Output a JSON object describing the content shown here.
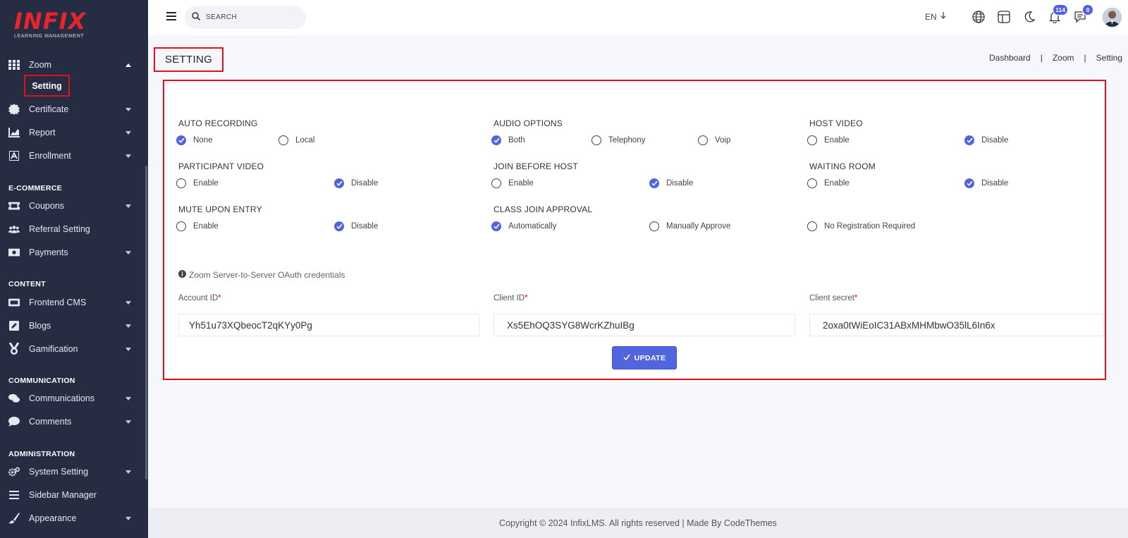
{
  "brand": {
    "logo_text": "INFIX",
    "logo_subtitle": "LEARNING MANAGEMENT"
  },
  "sidebar": {
    "items": [
      {
        "label": "Zoom",
        "icon": "grid-icon"
      },
      {
        "label": "Setting"
      },
      {
        "label": "Certificate",
        "icon": "certificate-icon"
      },
      {
        "label": "Report",
        "icon": "chart-icon"
      },
      {
        "label": "Enrollment",
        "icon": "enrollment-icon"
      },
      {
        "label": "Coupons",
        "icon": "ticket-icon"
      },
      {
        "label": "Referral Setting",
        "icon": "users-icon"
      },
      {
        "label": "Payments",
        "icon": "money-icon"
      },
      {
        "label": "Frontend CMS",
        "icon": "layers-icon"
      },
      {
        "label": "Blogs",
        "icon": "edit-icon"
      },
      {
        "label": "Gamification",
        "icon": "medal-icon"
      },
      {
        "label": "Communications",
        "icon": "chat-icon"
      },
      {
        "label": "Comments",
        "icon": "comment-icon"
      },
      {
        "label": "System Setting",
        "icon": "gears-icon"
      },
      {
        "label": "Sidebar Manager",
        "icon": "bars-icon"
      },
      {
        "label": "Appearance",
        "icon": "brush-icon"
      }
    ],
    "sections": [
      "E-COMMERCE",
      "CONTENT",
      "COMMUNICATION",
      "ADMINISTRATION"
    ]
  },
  "topbar": {
    "search_placeholder": "SEARCH",
    "language": "EN",
    "notifications_count": "114",
    "messages_count": "0"
  },
  "page": {
    "title": "SETTING",
    "breadcrumb": [
      "Dashboard",
      "|",
      "Zoom",
      "|",
      "Setting"
    ]
  },
  "settings": {
    "auto_recording": {
      "title": "AUTO RECORDING",
      "options": [
        "None",
        "Local"
      ],
      "selected": "None"
    },
    "audio_options": {
      "title": "AUDIO OPTIONS",
      "options": [
        "Both",
        "Telephony",
        "Voip"
      ],
      "selected": "Both"
    },
    "host_video": {
      "title": "HOST VIDEO",
      "options": [
        "Enable",
        "Disable"
      ],
      "selected": "Disable"
    },
    "participant_video": {
      "title": "PARTICIPANT VIDEO",
      "options": [
        "Enable",
        "Disable"
      ],
      "selected": "Disable"
    },
    "join_before_host": {
      "title": "JOIN BEFORE HOST",
      "options": [
        "Enable",
        "Disable"
      ],
      "selected": "Disable"
    },
    "waiting_room": {
      "title": "WAITING ROOM",
      "options": [
        "Enable",
        "Disable"
      ],
      "selected": "Disable"
    },
    "mute_upon_entry": {
      "title": "MUTE UPON ENTRY",
      "options": [
        "Enable",
        "Disable"
      ],
      "selected": "Disable"
    },
    "class_join_approval": {
      "title": "CLASS JOIN APPROVAL",
      "options": [
        "Automatically",
        "Manually Approve",
        "No Registration Required"
      ],
      "selected": "Automatically"
    }
  },
  "credentials": {
    "note": "Zoom Server-to-Server OAuth credentials",
    "account_id": {
      "label": "Account ID",
      "value": "Yh51u73XQbeocT2qKYy0Pg"
    },
    "client_id": {
      "label": "Client ID",
      "value": "Xs5EhOQ3SYG8WcrKZhuIBg"
    },
    "client_secret": {
      "label": "Client secret",
      "value": "2oxa0tWiEoIC31ABxMHMbwO35lL6In6x"
    },
    "required_mark": "*"
  },
  "actions": {
    "update_label": "UPDATE",
    "update_icon": "check-icon"
  },
  "footer": {
    "copyright": "Copyright © 2024 InfixLMS. All rights reserved | Made By CodeThemes"
  },
  "colors": {
    "sidebar": "#262d43",
    "accent": "#5166de",
    "highlight": "#e3101b",
    "logo": "#e8242d"
  }
}
